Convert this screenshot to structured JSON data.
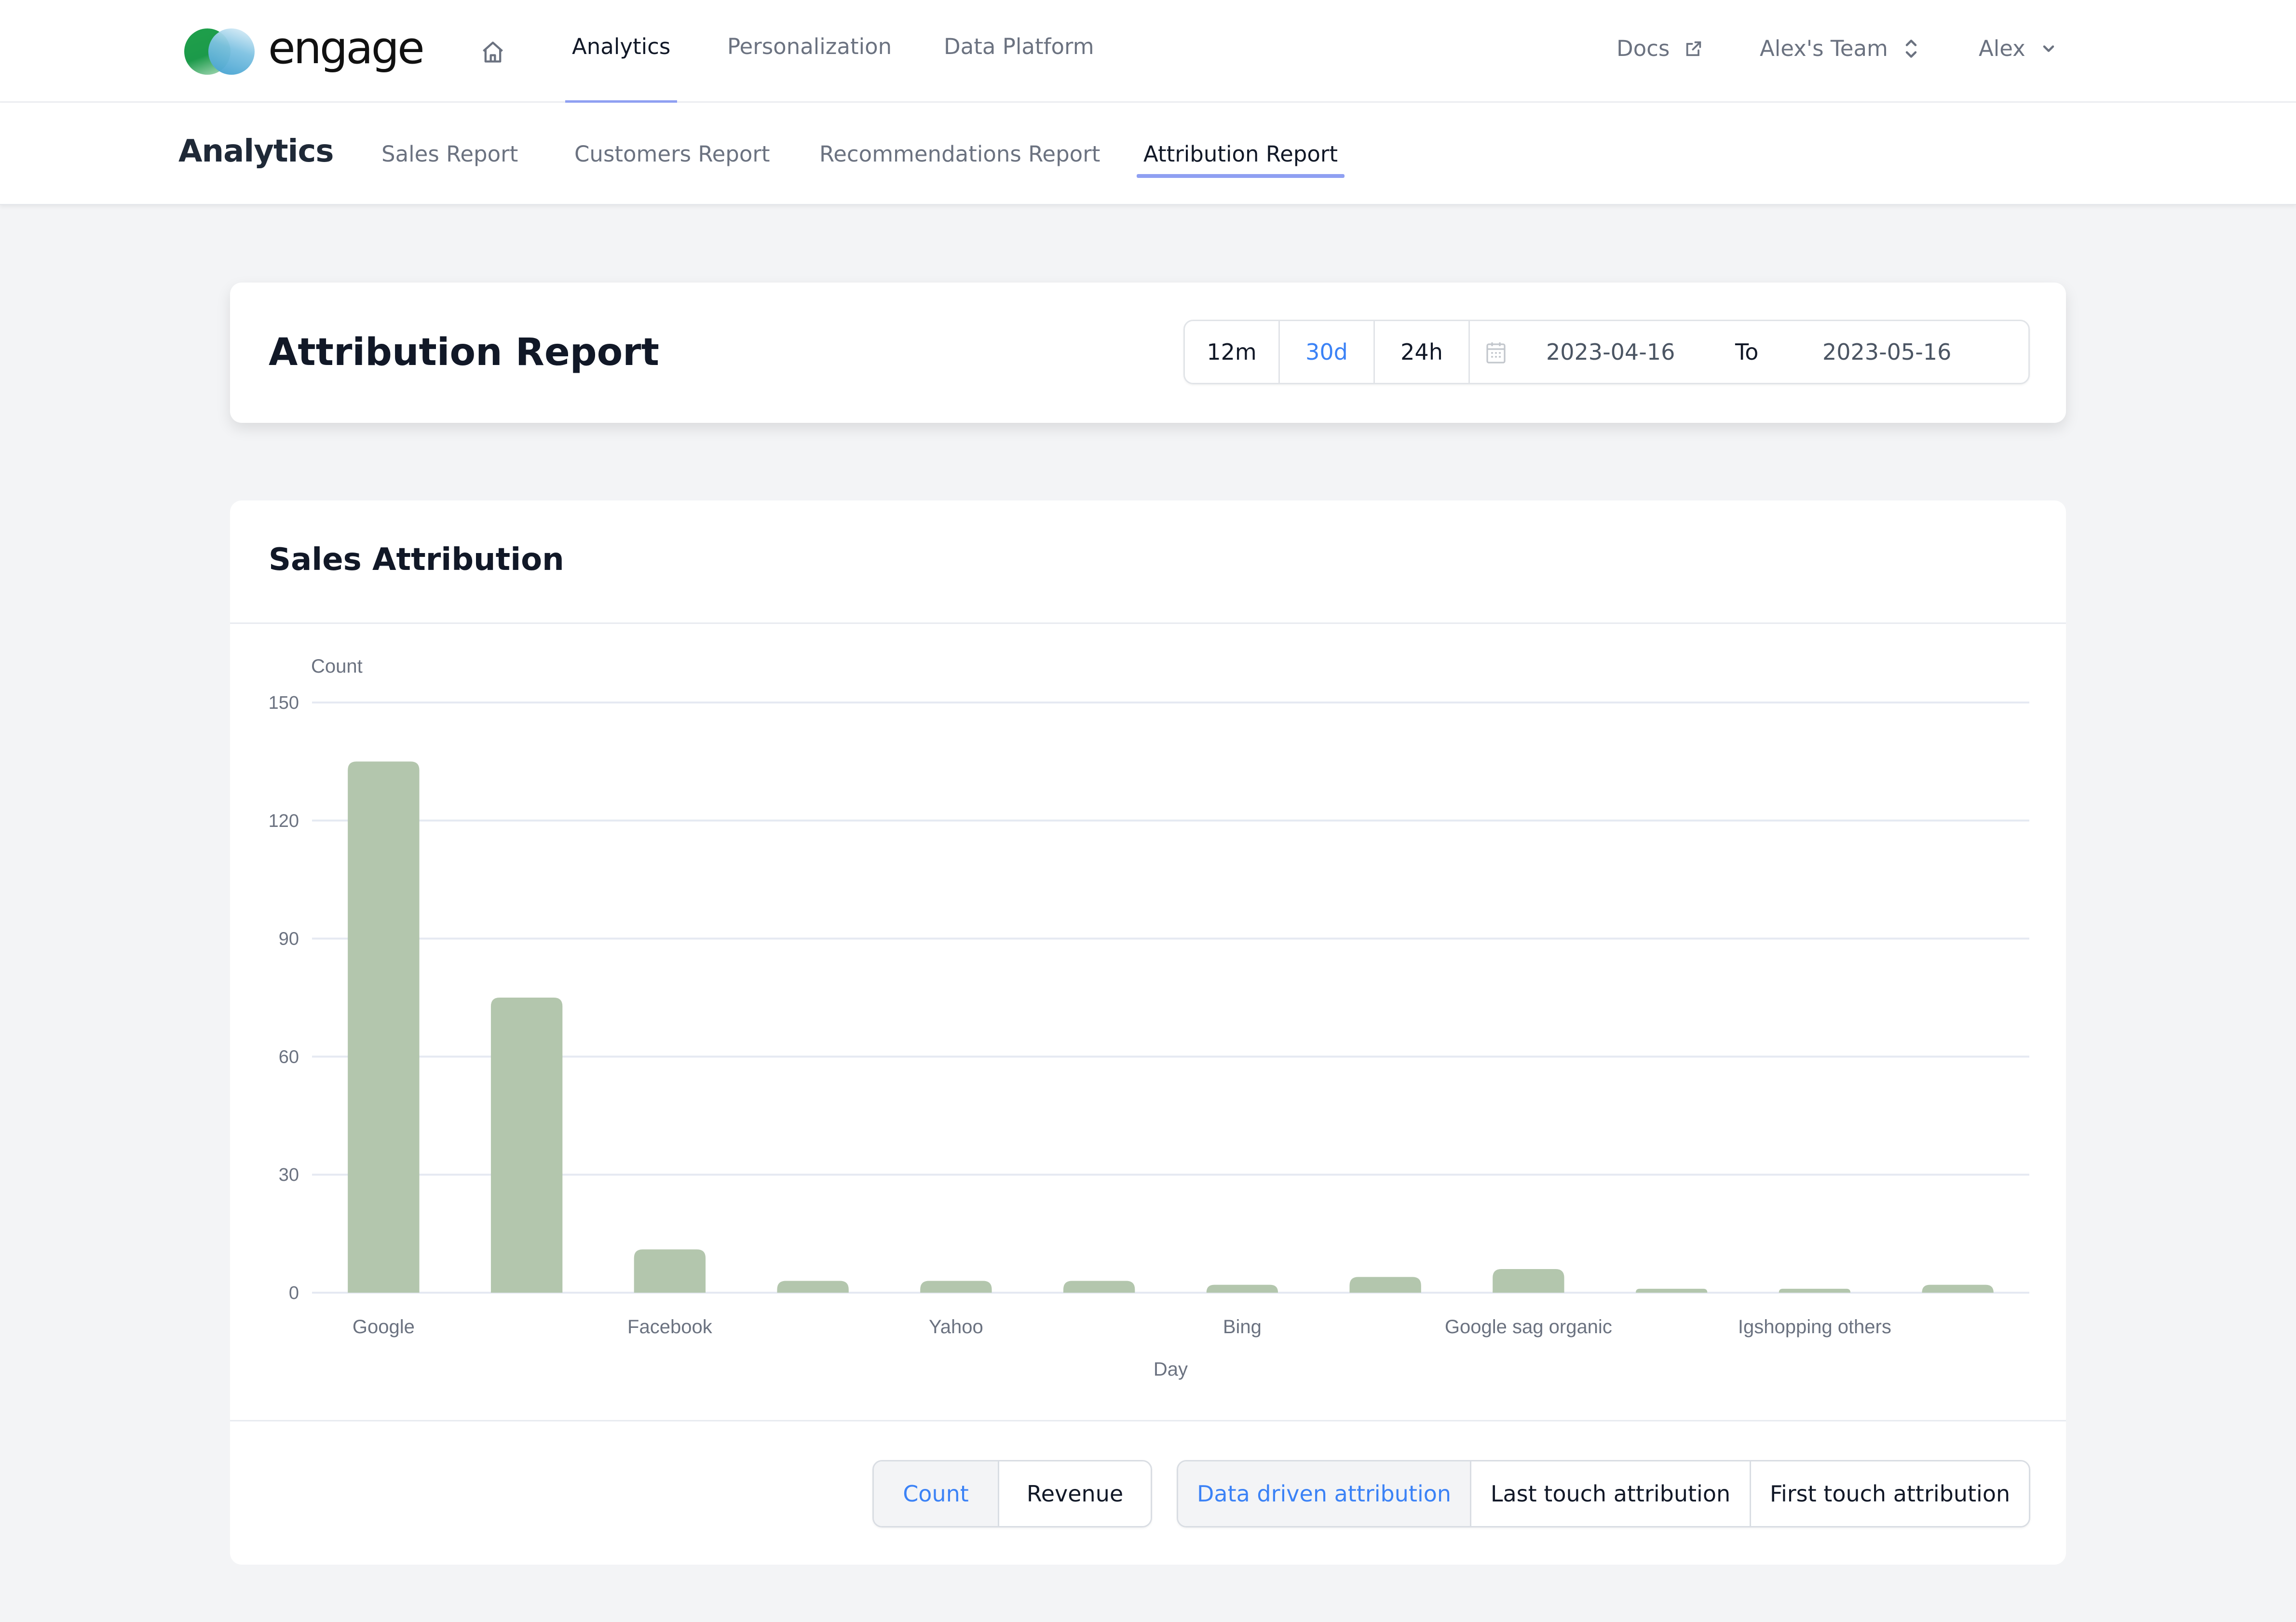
{
  "brand": {
    "name": "engage",
    "colors": {
      "green": "#1fa04b",
      "blue": "#3f9fcf"
    }
  },
  "topnav": {
    "home_icon": "home-icon",
    "links": [
      {
        "label": "Analytics",
        "active": true
      },
      {
        "label": "Personalization",
        "active": false
      },
      {
        "label": "Data Platform",
        "active": false
      }
    ],
    "docs_label": "Docs",
    "docs_icon": "external-link-icon",
    "team_label": "Alex's Team",
    "team_icon": "chevron-up-down-icon",
    "user_label": "Alex",
    "user_icon": "chevron-down-icon"
  },
  "subnav": {
    "title": "Analytics",
    "tabs": [
      {
        "label": "Sales Report",
        "active": false
      },
      {
        "label": "Customers Report",
        "active": false
      },
      {
        "label": "Recommendations Report",
        "active": false
      },
      {
        "label": "Attribution Report",
        "active": true
      }
    ]
  },
  "report_header": {
    "title": "Attribution Report",
    "ranges": [
      {
        "label": "12m",
        "active": false
      },
      {
        "label": "30d",
        "active": true
      },
      {
        "label": "24h",
        "active": false
      }
    ],
    "calendar_icon": "calendar-icon",
    "date_from": "2023-04-16",
    "date_separator": "To",
    "date_to": "2023-05-16"
  },
  "sales_attribution": {
    "title": "Sales Attribution",
    "metric_toggle": [
      {
        "label": "Count",
        "active": true
      },
      {
        "label": "Revenue",
        "active": false
      }
    ],
    "model_toggle": [
      {
        "label": "Data driven attribution",
        "active": true
      },
      {
        "label": "Last touch attribution",
        "active": false
      },
      {
        "label": "First touch attribution",
        "active": false
      }
    ]
  },
  "colors": {
    "accent": "#3b82f6",
    "tab_underline": "#8fa0f2",
    "bar": "#b3c6ad",
    "gridline": "#e5e9f2"
  },
  "chart_data": {
    "type": "bar",
    "title": "Sales Attribution",
    "xlabel": "Day",
    "ylabel": "Count",
    "ylim": [
      0,
      150
    ],
    "yticks": [
      0,
      30,
      60,
      90,
      120,
      150
    ],
    "grid": true,
    "legend": "none",
    "categories": [
      "Google",
      "",
      "Facebook",
      "",
      "Yahoo",
      "",
      "Bing",
      "",
      "Google sag organic",
      "",
      "Igshopping others",
      ""
    ],
    "values": [
      135,
      75,
      11,
      3,
      3,
      3,
      2,
      4,
      6,
      1,
      1,
      2
    ]
  }
}
